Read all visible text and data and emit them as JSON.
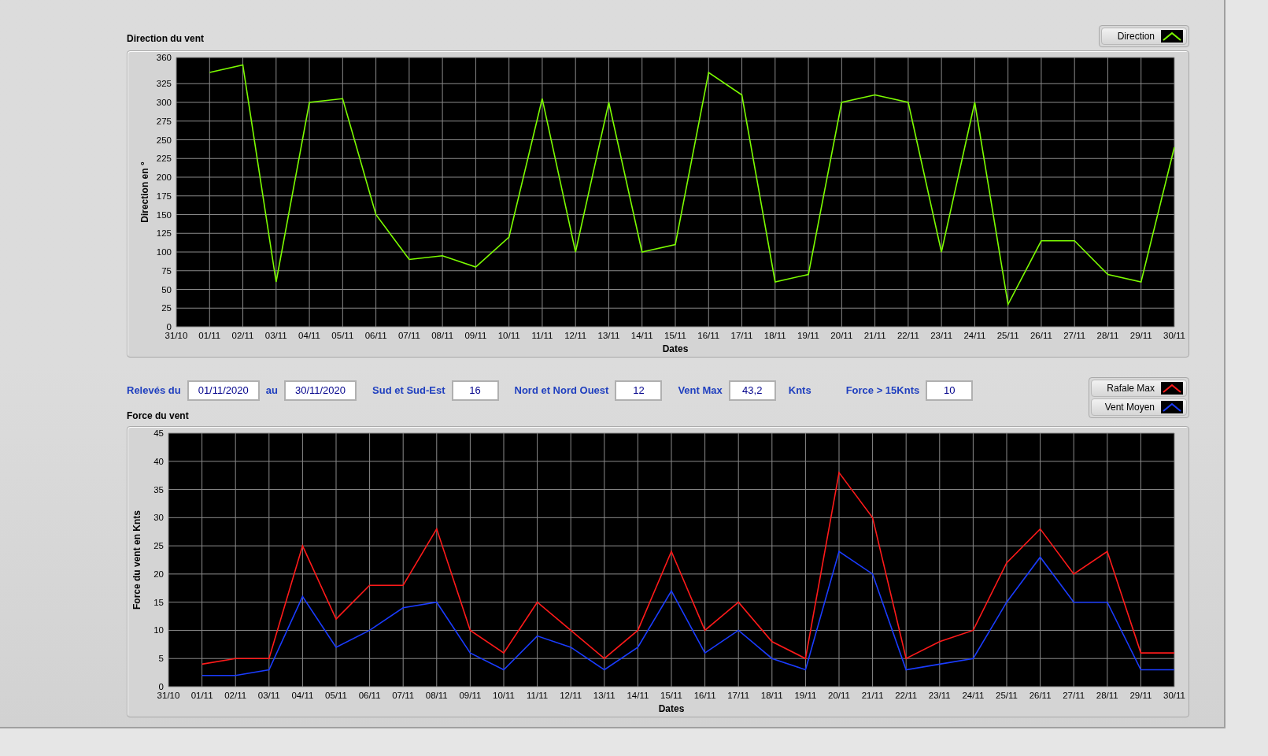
{
  "direction_chart": {
    "title": "Direction du vent",
    "chart_data": {
      "type": "line",
      "xlabel": "Dates",
      "ylabel": "Direction en °",
      "categories": [
        "31/10",
        "01/11",
        "02/11",
        "03/11",
        "04/11",
        "05/11",
        "06/11",
        "07/11",
        "08/11",
        "09/11",
        "10/11",
        "11/11",
        "12/11",
        "13/11",
        "14/11",
        "15/11",
        "16/11",
        "17/11",
        "18/11",
        "19/11",
        "20/11",
        "21/11",
        "22/11",
        "23/11",
        "24/11",
        "25/11",
        "26/11",
        "27/11",
        "28/11",
        "29/11",
        "30/11"
      ],
      "series": [
        {
          "name": "Direction",
          "color": "#7cfc00",
          "values": [
            null,
            340,
            350,
            60,
            300,
            305,
            150,
            90,
            95,
            80,
            120,
            305,
            100,
            300,
            100,
            110,
            340,
            310,
            60,
            70,
            300,
            310,
            300,
            100,
            300,
            30,
            115,
            115,
            70,
            60,
            240
          ]
        }
      ],
      "grid": true,
      "ylim": [
        0,
        360
      ],
      "yticks": [
        0,
        25,
        50,
        75,
        100,
        125,
        150,
        175,
        200,
        225,
        250,
        275,
        300,
        325,
        360
      ]
    }
  },
  "summary": [
    {
      "label": "Relevés du",
      "value": "01/11/2020"
    },
    {
      "label": "au",
      "value": "30/11/2020"
    },
    {
      "label": "Sud et Sud-Est",
      "value": "16"
    },
    {
      "label": "Nord et Nord Ouest",
      "value": "12"
    },
    {
      "label": "Vent Max",
      "value": "43,2",
      "unit": "Knts"
    },
    {
      "label": "Force > 15Knts",
      "value": "10"
    }
  ],
  "force_chart": {
    "title": "Force du vent",
    "chart_data": {
      "type": "line",
      "xlabel": "Dates",
      "ylabel": "Force du vent en Knts",
      "categories": [
        "31/10",
        "01/11",
        "02/11",
        "03/11",
        "04/11",
        "05/11",
        "06/11",
        "07/11",
        "08/11",
        "09/11",
        "10/11",
        "11/11",
        "12/11",
        "13/11",
        "14/11",
        "15/11",
        "16/11",
        "17/11",
        "18/11",
        "19/11",
        "20/11",
        "21/11",
        "22/11",
        "23/11",
        "24/11",
        "25/11",
        "26/11",
        "27/11",
        "28/11",
        "29/11",
        "30/11"
      ],
      "series": [
        {
          "name": "Rafale Max",
          "color": "#ff1a1a",
          "values": [
            null,
            4,
            5,
            5,
            25,
            12,
            18,
            18,
            28,
            10,
            6,
            15,
            10,
            5,
            10,
            24,
            10,
            15,
            8,
            5,
            38,
            30,
            5,
            8,
            10,
            22,
            28,
            20,
            24,
            6,
            6
          ]
        },
        {
          "name": "Vent Moyen",
          "color": "#1a3cff",
          "values": [
            null,
            2,
            2,
            3,
            16,
            7,
            10,
            14,
            15,
            6,
            3,
            9,
            7,
            3,
            7,
            17,
            6,
            10,
            5,
            3,
            24,
            20,
            3,
            4,
            5,
            15,
            23,
            15,
            15,
            3,
            3
          ]
        }
      ],
      "grid": true,
      "ylim": [
        0,
        45
      ],
      "yticks": [
        0,
        5,
        10,
        15,
        20,
        25,
        30,
        35,
        40,
        45
      ]
    }
  }
}
